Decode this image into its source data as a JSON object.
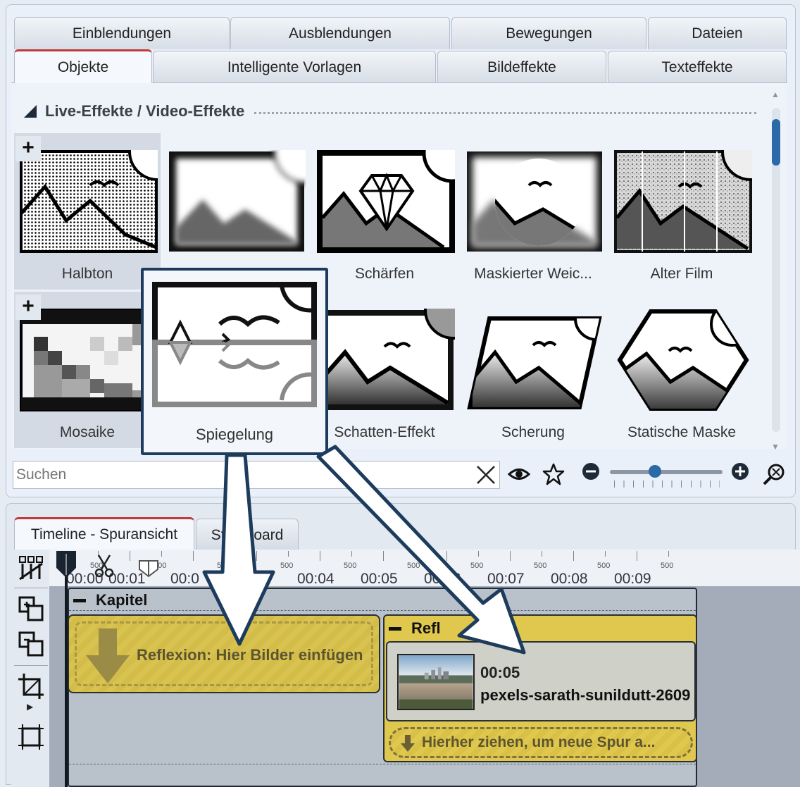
{
  "tabs_row1": [
    "Einblendungen",
    "Ausblendungen",
    "Bewegungen",
    "Dateien"
  ],
  "tabs_row2": [
    "Objekte",
    "Intelligente Vorlagen",
    "Bildeffekte",
    "Texteffekte"
  ],
  "section_title": "Live-Effekte / Video-Effekte",
  "effects": [
    {
      "label": "Halbton",
      "icon": "halftone-effect-icon"
    },
    {
      "label": "",
      "icon": "blur-effect-icon"
    },
    {
      "label": "Schärfen",
      "icon": "sharpen-effect-icon"
    },
    {
      "label": "Maskierter Weic...",
      "icon": "masked-soften-effect-icon"
    },
    {
      "label": "Alter Film",
      "icon": "old-film-effect-icon"
    },
    {
      "label": "Mosaike",
      "icon": "mosaic-effect-icon"
    },
    {
      "label": "Schatten-Effekt",
      "icon": "shadow-effect-icon"
    },
    {
      "label": "Scherung",
      "icon": "shear-effect-icon"
    },
    {
      "label": "Statische Maske",
      "icon": "static-mask-effect-icon"
    }
  ],
  "popup_label": "Spiegelung",
  "search": {
    "placeholder": "Suchen",
    "value": ""
  },
  "zoom_level": 0.4,
  "timeline_tabs": [
    "Timeline - Spuransicht",
    "Storyboard"
  ],
  "ruler": {
    "small_labels": [
      "500",
      "500",
      "500",
      "500",
      "500",
      "500",
      "500",
      "500",
      "500",
      "500"
    ],
    "time_labels": [
      "00:00",
      "00:01",
      "00:0",
      "00:04",
      "00:05",
      "00:06",
      "00:07",
      "00:08",
      "00:09"
    ]
  },
  "chapter_title": "Kapitel",
  "placeholder_text": "Reflexion: Hier Bilder einfügen",
  "reflexion_title": "Refl",
  "clip": {
    "duration": "00:05",
    "name": "pexels-sarath-sunildutt-2609"
  },
  "drop_text": "Hierher ziehen, um neue Spur a...",
  "colors": {
    "accent": "#2b6aa8",
    "track_yellow": "#e0c84e",
    "tab_active": "#c03a3a",
    "popup_border": "#1d3b5c"
  }
}
